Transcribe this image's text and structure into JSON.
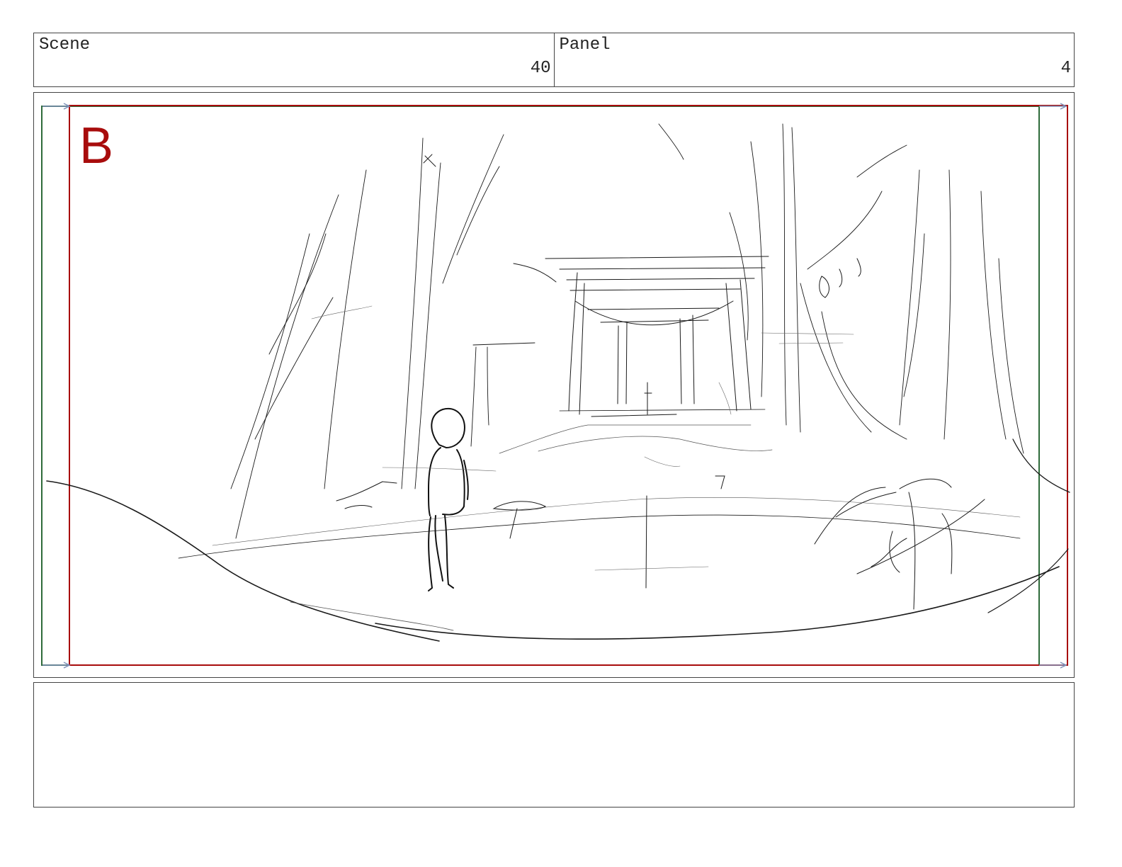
{
  "header": {
    "scene_label": "Scene",
    "scene_number": "40",
    "panel_label": "Panel",
    "panel_number": "4"
  },
  "frame": {
    "camera_label": "B",
    "colors": {
      "start_frame": "#2f6b3a",
      "end_frame": "#a80c0c",
      "sketch_line": "#1a1a1a",
      "guide_arrow": "#7d90b8"
    },
    "description_icons": [
      "torii-gate-sketch",
      "child-figure-sketch",
      "forest-trees-sketch"
    ]
  },
  "notes": {
    "text": ""
  }
}
